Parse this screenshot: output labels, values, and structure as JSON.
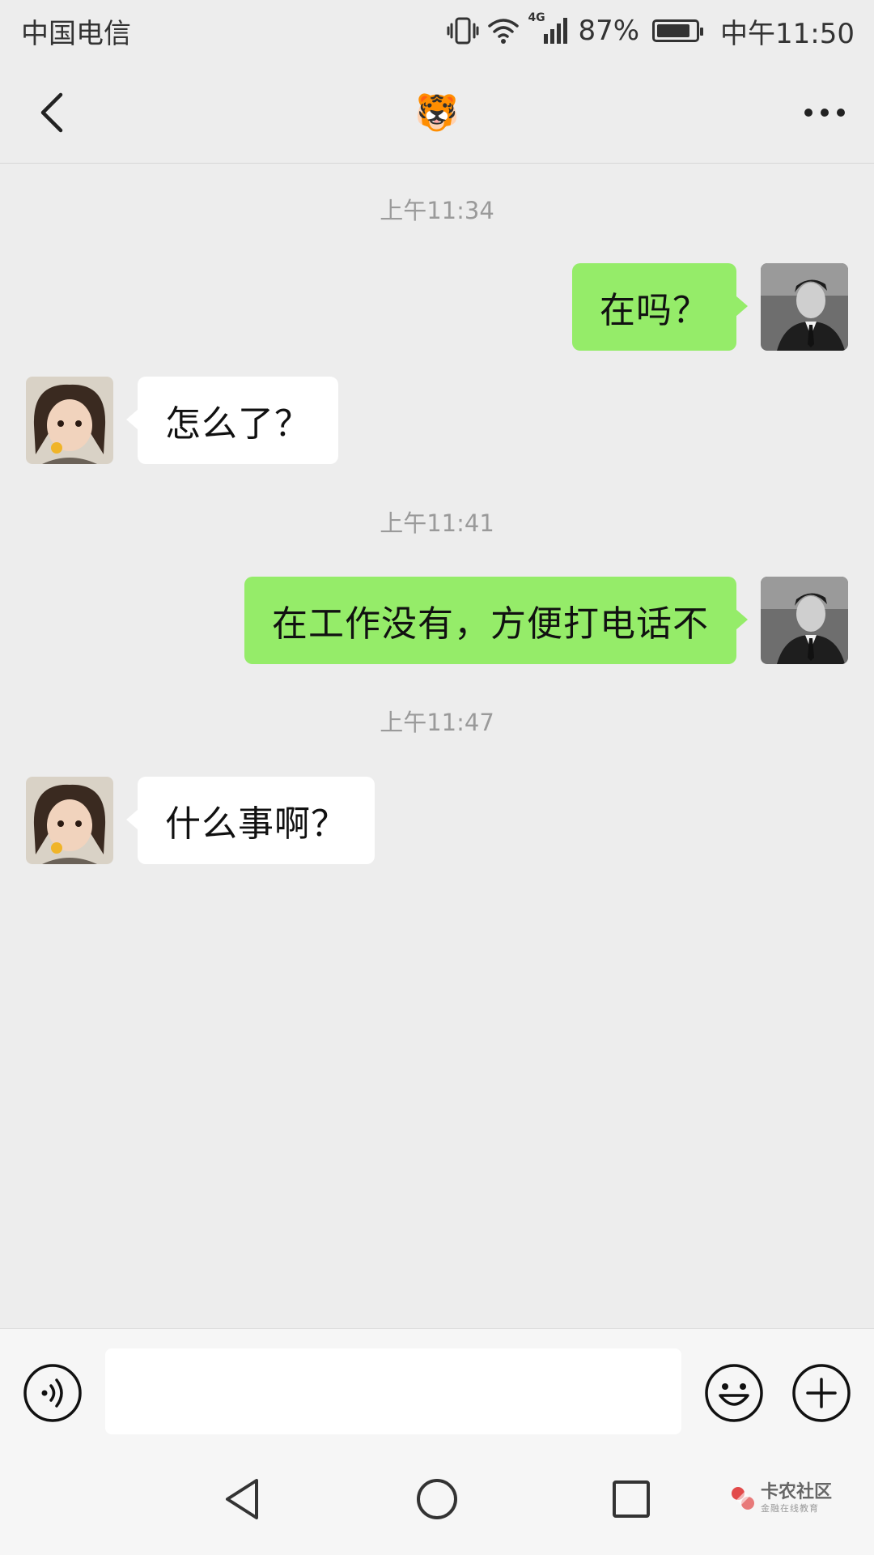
{
  "status_bar": {
    "carrier": "中国电信",
    "network": "4G",
    "battery_percent": "87%",
    "battery_level": 0.87,
    "time": "中午11:50"
  },
  "header": {
    "title": "🐯",
    "back_icon": "chevron-left-icon",
    "more_icon": "ellipsis-icon"
  },
  "messages": {
    "ts1": "上午11:34",
    "m1": "在吗？",
    "m2": "怎么了？",
    "ts2": "上午11:41",
    "m3": "在工作没有，方便打电话不",
    "ts3": "上午11:47",
    "m4": "什么事啊？"
  },
  "input_bar": {
    "value": "",
    "voice_icon": "voice-icon",
    "emoji_icon": "emoji-icon",
    "add_icon": "plus-icon"
  },
  "watermark": {
    "main": "卡农社区",
    "sub": "金融在线教育"
  },
  "colors": {
    "sent_bubble": "#95ec69",
    "received_bubble": "#ffffff",
    "background": "#ededed"
  }
}
